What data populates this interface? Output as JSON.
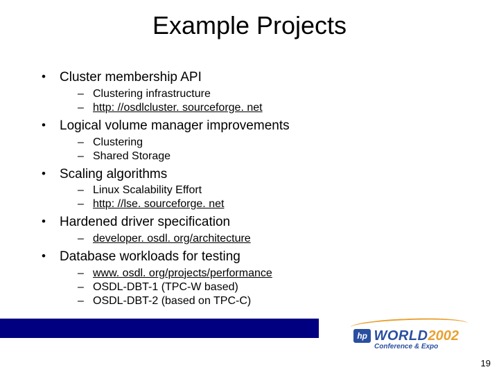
{
  "title": "Example Projects",
  "bullets": [
    {
      "label": "Cluster membership API",
      "sub": [
        {
          "text": "Clustering infrastructure",
          "link": false
        },
        {
          "text": "http: //osdlcluster. sourceforge. net",
          "link": true
        }
      ]
    },
    {
      "label": "Logical volume manager improvements",
      "sub": [
        {
          "text": "Clustering",
          "link": false
        },
        {
          "text": "Shared Storage",
          "link": false
        }
      ]
    },
    {
      "label": "Scaling algorithms",
      "sub": [
        {
          "text": "Linux Scalability Effort",
          "link": false
        },
        {
          "text": "http: //lse. sourceforge. net",
          "link": true
        }
      ]
    },
    {
      "label": "Hardened driver specification",
      "sub": [
        {
          "text": "developer. osdl. org/architecture",
          "link": true
        }
      ]
    },
    {
      "label": "Database workloads for testing",
      "sub": [
        {
          "text": "www. osdl. org/projects/performance",
          "link": true
        },
        {
          "text": "OSDL-DBT-1 (TPC-W based)",
          "link": false
        },
        {
          "text": "OSDL-DBT-2 (based on TPC-C)",
          "link": false
        }
      ]
    }
  ],
  "logo": {
    "hp": "hp",
    "world": "WORLD",
    "year": "2002",
    "sub": "Conference & Expo"
  },
  "page_number": "19"
}
